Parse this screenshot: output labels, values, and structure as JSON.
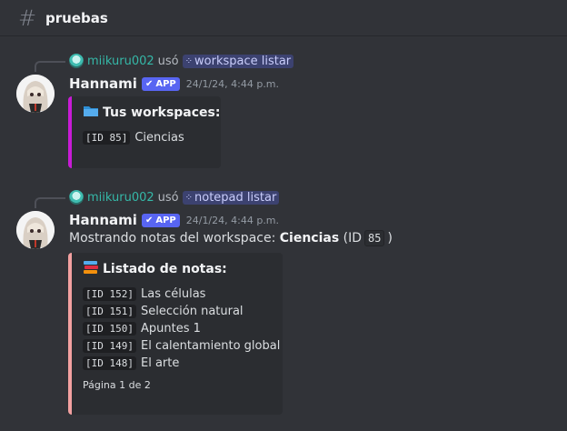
{
  "channel": {
    "name": "pruebas"
  },
  "messages": [
    {
      "reply_user": "miikuru002",
      "reply_used": "usó",
      "command": "workspace listar",
      "author": "Hannami",
      "badge": "APP",
      "timestamp": "24/1/24, 4:44 p.m.",
      "embed": {
        "accent": "#c81bd6",
        "title": "Tus workspaces:",
        "emoji": "folder-icon",
        "items": [
          {
            "id": "[ID 85]",
            "text": "Ciencias"
          }
        ]
      }
    },
    {
      "reply_user": "miikuru002",
      "reply_used": "usó",
      "command": "notepad listar",
      "author": "Hannami",
      "badge": "APP",
      "timestamp": "24/1/24, 4:44 p.m.",
      "content": {
        "prefix": "Mostrando notas del workspace:",
        "workspace": "Ciencias",
        "mid": "(ID",
        "id": "85",
        "suffix": ")"
      },
      "embed": {
        "accent": "#f2a0a0",
        "title": "Listado de notas:",
        "emoji": "books-icon",
        "items": [
          {
            "id": "[ID 152]",
            "text": "Las células"
          },
          {
            "id": "[ID 151]",
            "text": "Selección natural"
          },
          {
            "id": "[ID 150]",
            "text": "Apuntes 1"
          },
          {
            "id": "[ID 149]",
            "text": "El calentamiento global"
          },
          {
            "id": "[ID 148]",
            "text": "El arte"
          }
        ],
        "footer": "Página 1 de 2"
      }
    }
  ]
}
